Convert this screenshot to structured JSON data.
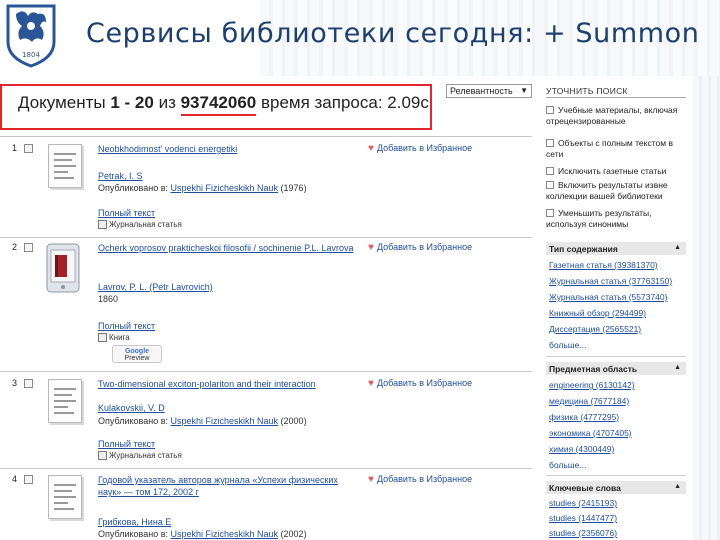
{
  "slide": {
    "title": "Сервисы библиотеки сегодня: + Summon",
    "logo_year": "1804"
  },
  "results_bar": {
    "prefix": "Документы ",
    "range": "1 - 20",
    "of": " из ",
    "total": "93742060",
    "time_label": " время запроса: 2.09с"
  },
  "sort": {
    "selected": "Релевантность"
  },
  "results": [
    {
      "index": "1",
      "title": "Neobkhodimost' vodenci energetiki",
      "author": "Petrak, I. S",
      "published_label": "Опубликовано в: ",
      "published_link": "Uspekhi Fizicheskikh Nauk",
      "published_year": " (1976)",
      "fulltext": "Полный текст",
      "type": "Журнальная статья",
      "fav": "Добавить в Избранное"
    },
    {
      "index": "2",
      "title": "Ocherk voprosov prakticheskoi filosofii / sochinenie P.L. Lavrova",
      "author": "Lavrov, P. L. (Petr Lavrovich)",
      "extra": "1860",
      "fulltext": "Полный текст",
      "type": "Книга",
      "preview_brand": "Google",
      "preview_label": "Preview",
      "fav": "Добавить в Избранное"
    },
    {
      "index": "3",
      "title": "Two-dimensional exciton-polariton and their interaction",
      "author": "Kulakovskii, V. D",
      "published_label": "Опубликовано в: ",
      "published_link": "Uspekhi Fizicheskikh Nauk",
      "published_year": " (2000)",
      "fulltext": "Полный текст",
      "type": "Журнальная статья",
      "fav": "Добавить в Избранное"
    },
    {
      "index": "4",
      "title": "Годовой указатель авторов журнала «Успехи физических наук» — том 172, 2002 г",
      "author": "Грибкова, Нина Е",
      "published_label": "Опубликовано в: ",
      "published_link": "Uspekhi Fizicheskikh Nauk",
      "published_year": " (2002)",
      "fav": "Добавить в Избранное"
    }
  ],
  "sidebar": {
    "refine_header": "УТОЧНИТЬ ПОИСК",
    "options": [
      "Учебные материалы, включая отрецензированные",
      "Объекты с полным текстом в сети",
      "Исключить газетные статьи",
      "Включить результаты извне коллекции вашей библиотеки",
      "Уменьшить результаты, используя синонимы"
    ],
    "facets": [
      {
        "title": "Тип содержания",
        "items": [
          "Газетная статья (39381370)",
          "Журнальная статья (37763150)",
          "Журнальная статья (5573740)",
          "Книжный обзор (294499)",
          "Диссертация (2565521)"
        ],
        "more": "больше..."
      },
      {
        "title": "Предметная область",
        "items": [
          "engineering (6130142)",
          "медицина (7677184)",
          "физика (4777295)",
          "экономика (4707405)",
          "химия (4300449)"
        ],
        "more": "больше..."
      },
      {
        "title": "Ключевые слова",
        "items": [
          "studies (2415193)",
          "studies (1447477)",
          "studies (2356076)"
        ]
      }
    ]
  }
}
